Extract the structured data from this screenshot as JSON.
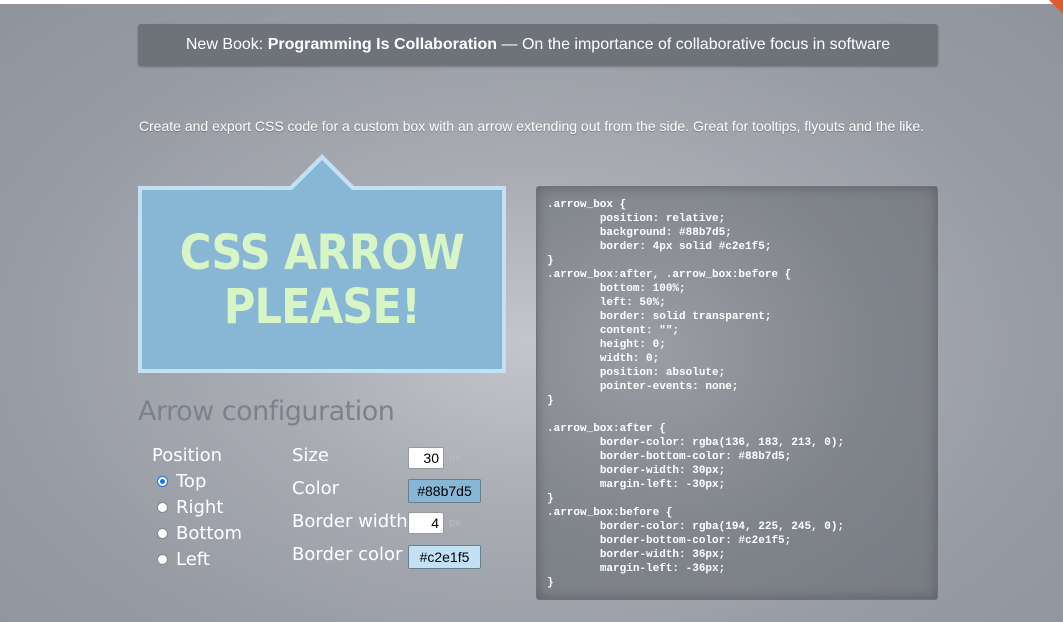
{
  "banner": {
    "prefix": "New Book: ",
    "book_title": "Programming Is Collaboration",
    "suffix": " — On the importance of collaborative focus in software"
  },
  "tagline": "Create and export CSS code for a custom box with an arrow extending out from the side. Great for tooltips, flyouts and the like.",
  "preview": {
    "line1": "CSS ARROW",
    "line2": "PLEASE!"
  },
  "config": {
    "title": "Arrow configuration",
    "position_label": "Position",
    "positions": [
      {
        "label": "Top",
        "checked": true
      },
      {
        "label": "Right",
        "checked": false
      },
      {
        "label": "Bottom",
        "checked": false
      },
      {
        "label": "Left",
        "checked": false
      }
    ],
    "size_label": "Size",
    "size_value": "30",
    "size_unit": "px",
    "color_label": "Color",
    "color_value": "#88b7d5",
    "border_width_label": "Border width",
    "border_width_value": "4",
    "border_width_unit": "px",
    "border_color_label": "Border color",
    "border_color_value": "#c2e1f5"
  },
  "colors": {
    "box_background": "#88b7d5",
    "box_border": "#c2e1f5",
    "preview_text": "#d8f5c6"
  },
  "code": ".arrow_box {\n\tposition: relative;\n\tbackground: #88b7d5;\n\tborder: 4px solid #c2e1f5;\n}\n.arrow_box:after, .arrow_box:before {\n\tbottom: 100%;\n\tleft: 50%;\n\tborder: solid transparent;\n\tcontent: \"\";\n\theight: 0;\n\twidth: 0;\n\tposition: absolute;\n\tpointer-events: none;\n}\n\n.arrow_box:after {\n\tborder-color: rgba(136, 183, 213, 0);\n\tborder-bottom-color: #88b7d5;\n\tborder-width: 30px;\n\tmargin-left: -30px;\n}\n.arrow_box:before {\n\tborder-color: rgba(194, 225, 245, 0);\n\tborder-bottom-color: #c2e1f5;\n\tborder-width: 36px;\n\tmargin-left: -36px;\n}"
}
